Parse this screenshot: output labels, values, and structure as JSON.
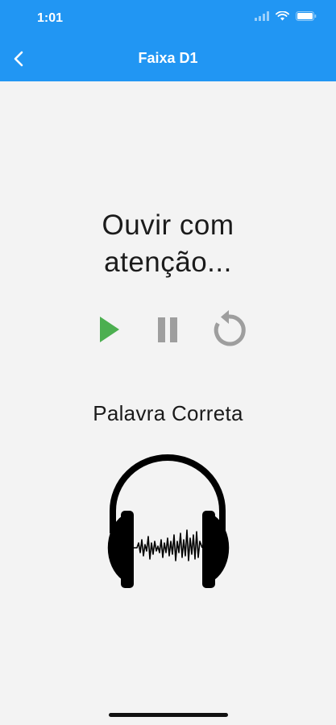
{
  "status_bar": {
    "time": "1:01",
    "icons": [
      "cellular-signal-icon",
      "wifi-icon",
      "battery-icon"
    ]
  },
  "app_bar": {
    "title": "Faixa D1",
    "back_icon": "chevron-left-icon",
    "background_color": "#2196f3"
  },
  "main": {
    "instruction": "Ouvir com atenção...",
    "controls": {
      "play_icon": "play-icon",
      "pause_icon": "pause-icon",
      "replay_icon": "replay-icon",
      "play_color": "#4caf50",
      "inactive_color": "#9e9e9e"
    },
    "subtitle": "Palavra Correta",
    "image_icon": "headphones-soundwave-icon"
  }
}
